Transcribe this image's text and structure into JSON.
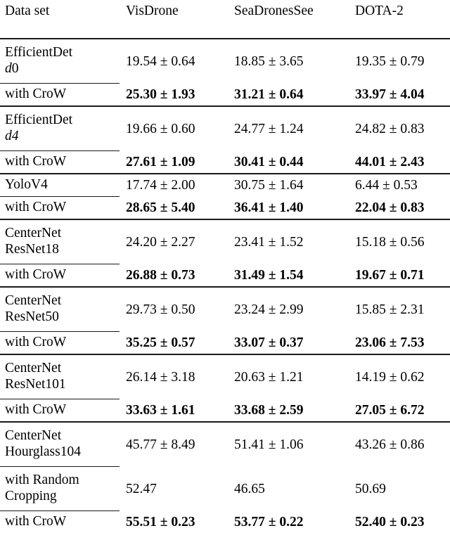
{
  "table": {
    "columns": [
      {
        "key": "model",
        "label": "Data set"
      },
      {
        "key": "visdrone",
        "label": "VisDrone"
      },
      {
        "key": "seadronessee",
        "label": "SeaDronesSee"
      },
      {
        "key": "dota2",
        "label": "DOTA-2"
      }
    ],
    "groups": [
      {
        "id": "efficientdet-d0",
        "model": {
          "line1": "EfficientDet",
          "line2_italic": "d",
          "line2_rest": "0"
        },
        "base": {
          "visdrone": "19.54 ± 0.64",
          "seadronessee": "18.85 ± 3.65",
          "dota2": "19.35 ± 0.79"
        },
        "variants": [
          {
            "label": "with CroW",
            "bold": true,
            "visdrone": "25.30 ± 1.93",
            "seadronessee": "31.21 ± 0.64",
            "dota2": "33.97 ± 4.04"
          }
        ]
      },
      {
        "id": "efficientdet-d4",
        "model": {
          "line1": "EfficientDet",
          "line2_italic": "d4",
          "line2_rest": ""
        },
        "base": {
          "visdrone": "19.66 ± 0.60",
          "seadronessee": "24.77 ± 1.24",
          "dota2": "24.82 ± 0.83"
        },
        "variants": [
          {
            "label": "with CroW",
            "bold": true,
            "visdrone": "27.61 ± 1.09",
            "seadronessee": "30.41 ± 0.44",
            "dota2": "44.01 ± 2.43"
          }
        ]
      },
      {
        "id": "yolov4",
        "model": {
          "line1": "YoloV4",
          "line2_italic": "",
          "line2_rest": ""
        },
        "base": {
          "visdrone": "17.74 ± 2.00",
          "seadronessee": "30.75 ± 1.64",
          "dota2": "6.44 ± 0.53"
        },
        "variants": [
          {
            "label": "with CroW",
            "bold": true,
            "visdrone": "28.65 ± 5.40",
            "seadronessee": "36.41 ± 1.40",
            "dota2": "22.04 ± 0.83"
          }
        ]
      },
      {
        "id": "centernet-resnet18",
        "model": {
          "line1": "CenterNet",
          "line2_italic": "",
          "line2_rest": "ResNet18"
        },
        "base": {
          "visdrone": "24.20 ± 2.27",
          "seadronessee": "23.41 ± 1.52",
          "dota2": "15.18 ± 0.56"
        },
        "variants": [
          {
            "label": "with CroW",
            "bold": true,
            "visdrone": "26.88 ± 0.73",
            "seadronessee": "31.49 ± 1.54",
            "dota2": "19.67 ± 0.71"
          }
        ]
      },
      {
        "id": "centernet-resnet50",
        "model": {
          "line1": "CenterNet",
          "line2_italic": "",
          "line2_rest": "ResNet50"
        },
        "base": {
          "visdrone": "29.73 ± 0.50",
          "seadronessee": "23.24 ± 2.99",
          "dota2": "15.85 ± 2.31"
        },
        "variants": [
          {
            "label": "with CroW",
            "bold": true,
            "visdrone": "35.25 ± 0.57",
            "seadronessee": "33.07 ± 0.37",
            "dota2": "23.06 ± 7.53"
          }
        ]
      },
      {
        "id": "centernet-resnet101",
        "model": {
          "line1": "CenterNet",
          "line2_italic": "",
          "line2_rest": "ResNet101"
        },
        "base": {
          "visdrone": "26.14 ± 3.18",
          "seadronessee": "20.63 ± 1.21",
          "dota2": "14.19 ± 0.62"
        },
        "variants": [
          {
            "label": "with CroW",
            "bold": true,
            "visdrone": "33.63 ± 1.61",
            "seadronessee": "33.68 ± 2.59",
            "dota2": "27.05 ± 6.72"
          }
        ]
      },
      {
        "id": "centernet-hourglass104",
        "model": {
          "line1": "CenterNet",
          "line2_italic": "",
          "line2_rest": "Hourglass104"
        },
        "base": {
          "visdrone": "45.77 ± 8.49",
          "seadronessee": "51.41 ± 1.06",
          "dota2": "43.26 ± 0.86"
        },
        "variants": [
          {
            "label_line1": "with Random",
            "label_line2": "Cropping",
            "bold": false,
            "visdrone": "52.47",
            "seadronessee": "46.65",
            "dota2": "50.69"
          },
          {
            "label": "with CroW",
            "bold": true,
            "visdrone": "55.51 ± 0.23",
            "seadronessee": "53.77 ± 0.22",
            "dota2": "52.40 ± 0.23"
          }
        ]
      }
    ]
  }
}
